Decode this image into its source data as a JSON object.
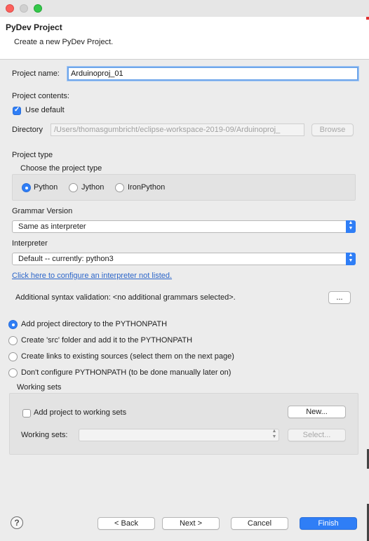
{
  "dialog": {
    "title": "PyDev Project",
    "subtitle": "Create a new PyDev Project."
  },
  "project": {
    "name_label": "Project name:",
    "name_value": "Arduinoproj_01",
    "contents_label": "Project contents:",
    "use_default_label": "Use default",
    "use_default_checked": true,
    "directory_label": "Directory",
    "directory_value": "/Users/thomasgumbricht/eclipse-workspace-2019-09/Arduinoproj_",
    "browse_label": "Browse"
  },
  "project_type": {
    "section_label": "Project type",
    "choose_label": "Choose the project type",
    "options": [
      "Python",
      "Jython",
      "IronPython"
    ],
    "selected": "Python"
  },
  "grammar": {
    "label": "Grammar Version",
    "value": "Same as interpreter"
  },
  "interpreter": {
    "label": "Interpreter",
    "value": "Default  --  currently: python3",
    "configure_link": "Click here to configure an interpreter not listed."
  },
  "syntax": {
    "label": "Additional syntax validation: <no additional grammars selected>.",
    "button_label": "..."
  },
  "pythonpath": {
    "options": [
      "Add project directory to the PYTHONPATH",
      "Create 'src' folder and add it to the PYTHONPATH",
      "Create links to existing sources (select them on the next page)",
      "Don't configure PYTHONPATH (to be done manually later on)"
    ],
    "selected_index": 0
  },
  "working_sets": {
    "section_label": "Working sets",
    "add_label": "Add project to working sets",
    "add_checked": false,
    "new_label": "New...",
    "sets_label": "Working sets:",
    "sets_value": "",
    "select_label": "Select..."
  },
  "footer": {
    "help_icon": "?",
    "back_label": "< Back",
    "next_label": "Next >",
    "cancel_label": "Cancel",
    "finish_label": "Finish"
  },
  "colors": {
    "accent": "#2f7ef6",
    "link": "#2b65c9",
    "background": "#ececec"
  }
}
